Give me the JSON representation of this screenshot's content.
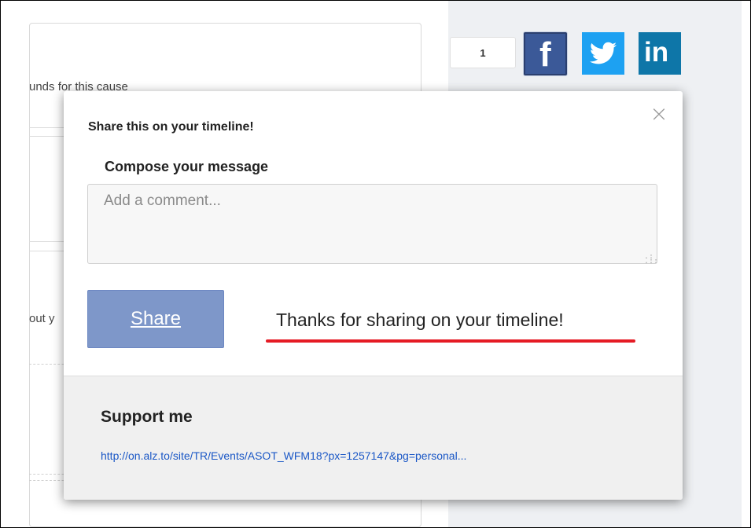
{
  "background": {
    "funds_text": "unds for this cause",
    "about_text": "out y"
  },
  "share_count": "1",
  "social": {
    "facebook_glyph": "f",
    "linkedin_glyph": "in"
  },
  "modal": {
    "title": "Share this on your timeline!",
    "close_glyph": "×",
    "compose_label": "Compose your message",
    "comment_placeholder": "Add a comment...",
    "share_label": "Share",
    "thanks_text": "Thanks for sharing on your timeline!",
    "support_title": "Support me",
    "support_link": "http://on.alz.to/site/TR/Events/ASOT_WFM18?px=1257147&pg=personal..."
  },
  "colors": {
    "facebook": "#3b5998",
    "twitter": "#1da1f2",
    "linkedin": "#0e76a8",
    "share_button": "#7e97c9",
    "highlight_underline": "#e51b24",
    "link": "#1a57c6"
  }
}
